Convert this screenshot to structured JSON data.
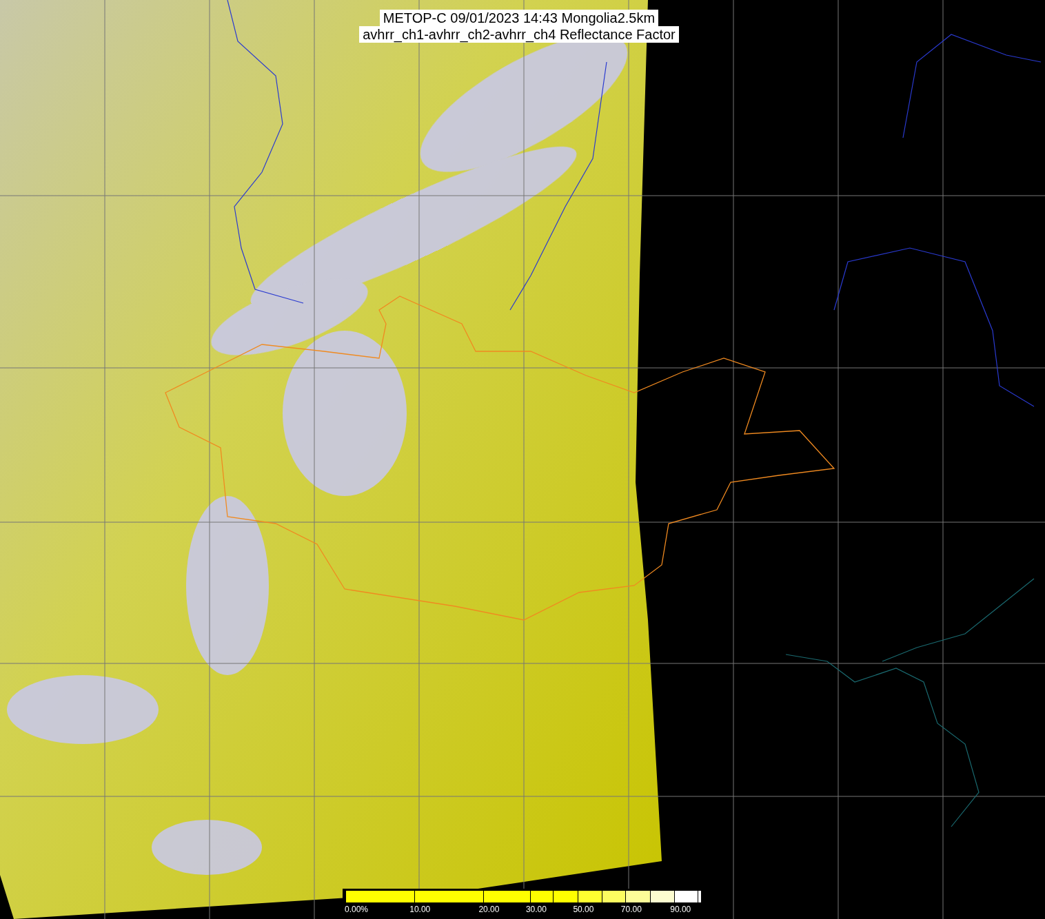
{
  "title": {
    "lines": [
      "METOP-C 09/01/2023 14:43 Mongolia2.5km",
      "avhrr_ch1-avhrr_ch2-avhrr_ch4 Reflectance Factor"
    ]
  },
  "colorbar": {
    "segments": [
      {
        "color": "#ffff00",
        "label": "0.00%"
      },
      {
        "color": "#ffff00",
        "label": "10.00"
      },
      {
        "color": "#ffff00",
        "label": "20.00"
      },
      {
        "color": "#ffff00",
        "label": "30.00"
      },
      {
        "color": "#ffff00"
      },
      {
        "color": "#ffff30",
        "label": "50.00"
      },
      {
        "color": "#fcfc60"
      },
      {
        "color": "#fcfc98",
        "label": "70.00"
      },
      {
        "color": "#fcfcd0"
      },
      {
        "color": "#ffffff",
        "label": "90.00"
      },
      {
        "color": "#ffffff"
      }
    ]
  }
}
